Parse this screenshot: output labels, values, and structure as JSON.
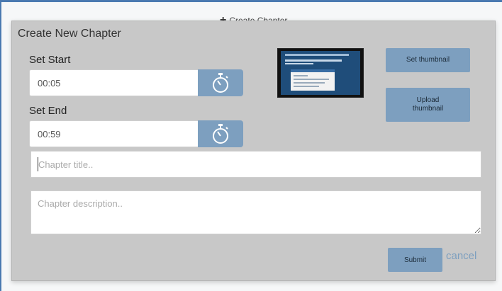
{
  "background": {
    "header_text": "Create Chapter"
  },
  "modal": {
    "title": "Create New Chapter",
    "start": {
      "label": "Set Start",
      "value": "00:05"
    },
    "end": {
      "label": "Set End",
      "value": "00:59"
    },
    "timer_icon": "stopwatch-icon",
    "thumbnail_preview_icon": "thumbnail-preview",
    "set_thumbnail_label": "Set thumbnail",
    "upload_thumbnail_label": "Upload\nthumbnail",
    "chapter_title": {
      "value": "",
      "placeholder": "Chapter title.."
    },
    "chapter_description": {
      "value": "",
      "placeholder": "Chapter description.."
    },
    "submit_label": "Submit",
    "cancel_label": "cancel"
  },
  "colors": {
    "accent": "#7d9fbf",
    "modal_bg": "#c8c8c8",
    "border_accent": "#4a79b0"
  }
}
